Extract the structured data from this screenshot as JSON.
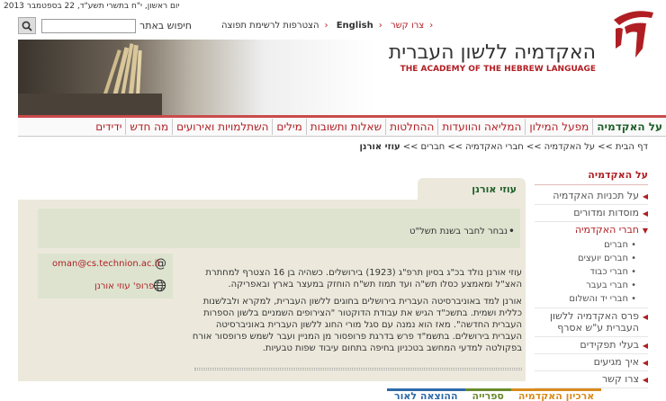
{
  "date_line": "יום ראשון, י\"ח בתשרי תשע\"ד, 22 בספטמבר 2013",
  "search": {
    "label": "חיפוש באתר",
    "value": "",
    "placeholder": ""
  },
  "top_nav": {
    "contact": "צרו קשר",
    "english": "English",
    "mailing": "הצטרפות לרשימת תפוצה"
  },
  "header": {
    "title": "האקדמיה ללשון העברית",
    "subtitle": "THE ACADEMY OF THE HEBREW LANGUAGE"
  },
  "main_menu": [
    "על האקדמיה",
    "מפעל המילון",
    "המליאה והוועדות",
    "ההחלטות",
    "שאלות ותשובות",
    "מילים",
    "השתלמויות ואירועים",
    "מה חדש",
    "ידידים"
  ],
  "breadcrumb": [
    "דף הבית",
    ">>",
    "על האקדמיה",
    ">>",
    "חברי האקדמיה",
    ">>",
    "חברים",
    ">>",
    "עוזי אורנן"
  ],
  "side_nav": {
    "title": "על האקדמיה",
    "items": [
      {
        "label": "על תכניות האקדמיה",
        "sub": []
      },
      {
        "label": "מוסדות ומדורים",
        "sub": []
      },
      {
        "label": "חברי האקדמיה",
        "active": true,
        "sub": [
          "חברים",
          "חברים יועצים",
          "חברי כבוד",
          "חברי בעבר",
          "חברי יד והשלום"
        ]
      },
      {
        "label": "פרס האקדמיה ללשון העברית ע\"ש אסרף",
        "sub": []
      },
      {
        "label": "בעלי תפקידים",
        "sub": []
      },
      {
        "label": "איך מגיעים",
        "sub": []
      },
      {
        "label": "צרו קשר",
        "sub": []
      }
    ]
  },
  "content": {
    "tab_title": "עוזי אורנן",
    "notice": "נבחר לחבר בשנת תשל\"ט",
    "email": "oman@cs.technion.ac.il",
    "website": "פרופ' עוזי אורנן",
    "bio_paragraphs": [
      "עוזי אורנן נולד בכ\"ג בסיון תרפ\"ג (1923) בירושלים. כשהיה בן 16 הצטרף למחתרת האצ\"ל ומאמצע כסלו תש\"ה ועד תמוז תש\"ח הוחזק במעצר בארץ ובאפריקה.",
      "אורנן למד באוניברסיטה העברית בירושלים בחוגים ללשון העברית, למקרא ולבלשנות כללית ושמית. בתשכ\"ד הגיש את עבודת הדוקטור \"הצירופים השמניים בלשון הספרות העברית החדשה\". מאז הוא נמנה עם סגל מורי החוג ללשון העברית באוניברסיטה העברית בירושלים. בתשמ\"ד פרש בדרגת פרופסור מן המניין ועבר לשמש פרופסור אורח בפקולטה למדעי המחשב בטכניון בחיפה בתחום עיבוד שפות טבעיות."
    ]
  },
  "bottom_tabs": [
    {
      "label": "ארכיון האקדמיה",
      "color": "#d98b1e"
    },
    {
      "label": "ספרייה",
      "color": "#6a8a2c"
    },
    {
      "label": "ההוצאה לאור",
      "color": "#2e6aa8"
    }
  ],
  "colors": {
    "accent_red": "#b01e23",
    "green": "#1f5f2a",
    "panel": "#ece9dc",
    "notice": "#dde3cf"
  }
}
